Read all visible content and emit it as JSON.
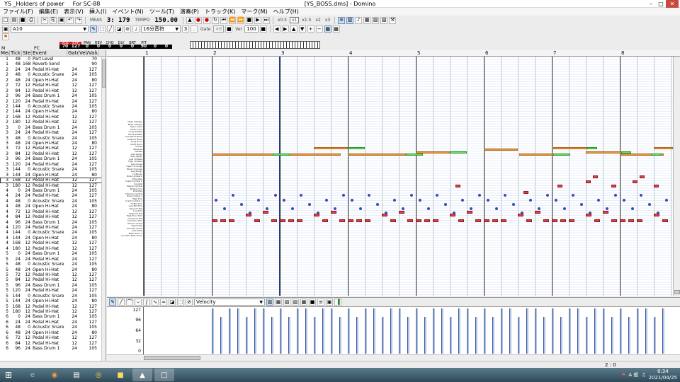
{
  "titlebar": {
    "app_name": "YS _Holders of power",
    "device": "For SC-88",
    "document": "[YS_BOSS.dms] - Domino"
  },
  "menu": [
    "ファイル(F)",
    "編集(E)",
    "表示(V)",
    "挿入(I)",
    "イベント(N)",
    "ツール(T)",
    "演奏(P)",
    "トラック(K)",
    "マーク(M)",
    "ヘルプ(H)"
  ],
  "toolbar": {
    "meas_label": "MEAS",
    "position": "3: 179",
    "tempo_label": "TEMPO",
    "tempo": "150.00",
    "zoom": [
      "x0.5",
      "x1",
      "x1.5",
      "x2",
      "x3"
    ],
    "track_select": "A10",
    "note_length": "16分音符",
    "gate_label": "Gate",
    "gate_value": "48",
    "vel_label": "Vel",
    "vel_value": "100"
  },
  "mixer": {
    "labels": [
      "VOL",
      "EXP",
      "PAN",
      "REV",
      "CHO",
      "DLY",
      "BRT",
      "PIT"
    ],
    "values": [
      "70",
      "127",
      "0",
      "0",
      "0",
      "0",
      "0",
      "90",
      "0",
      "0"
    ],
    "channel_m": "M",
    "channel_p": "PC"
  },
  "eventlist": {
    "headers": [
      "Mea",
      "Tick",
      "Step",
      "Event",
      "Gate",
      "Vel/Value"
    ],
    "rows": [
      [
        "1",
        "48",
        "0",
        "Part Level",
        "",
        "70"
      ],
      [
        "1",
        "48",
        "168",
        "Reverb Send",
        "",
        "90"
      ],
      [
        "2",
        "24",
        "24",
        "Pedal Hi-Hat",
        "24",
        "127"
      ],
      [
        "2",
        "48",
        "0",
        "Acoustic Snare",
        "24",
        "105"
      ],
      [
        "2",
        "48",
        "24",
        "Open Hi-Hat",
        "24",
        "80"
      ],
      [
        "2",
        "72",
        "12",
        "Pedal Hi-Hat",
        "12",
        "127"
      ],
      [
        "2",
        "84",
        "12",
        "Pedal Hi-Hat",
        "12",
        "127"
      ],
      [
        "2",
        "96",
        "24",
        "Bass Drum 1",
        "24",
        "105"
      ],
      [
        "2",
        "120",
        "24",
        "Pedal Hi-Hat",
        "24",
        "127"
      ],
      [
        "2",
        "144",
        "0",
        "Acoustic Snare",
        "24",
        "105"
      ],
      [
        "2",
        "144",
        "24",
        "Open Hi-Hat",
        "24",
        "80"
      ],
      [
        "2",
        "168",
        "12",
        "Pedal Hi-Hat",
        "12",
        "127"
      ],
      [
        "2",
        "180",
        "12",
        "Pedal Hi-Hat",
        "12",
        "127"
      ],
      [
        "3",
        "0",
        "24",
        "Bass Drum 1",
        "24",
        "105"
      ],
      [
        "3",
        "24",
        "24",
        "Pedal Hi-Hat",
        "24",
        "127"
      ],
      [
        "3",
        "48",
        "0",
        "Acoustic Snare",
        "24",
        "105"
      ],
      [
        "3",
        "48",
        "24",
        "Open Hi-Hat",
        "24",
        "80"
      ],
      [
        "3",
        "72",
        "12",
        "Pedal Hi-Hat",
        "12",
        "127"
      ],
      [
        "3",
        "84",
        "12",
        "Pedal Hi-Hat",
        "12",
        "127"
      ],
      [
        "3",
        "96",
        "24",
        "Bass Drum 1",
        "24",
        "105"
      ],
      [
        "3",
        "120",
        "24",
        "Pedal Hi-Hat",
        "24",
        "127"
      ],
      [
        "3",
        "144",
        "0",
        "Acoustic Snare",
        "24",
        "105"
      ],
      [
        "3",
        "144",
        "24",
        "Open Hi-Hat",
        "24",
        "80"
      ],
      [
        "3",
        "168",
        "12",
        "Pedal Hi-Hat",
        "12",
        "127"
      ],
      [
        "3",
        "180",
        "12",
        "Pedal Hi-Hat",
        "12",
        "127"
      ],
      [
        "4",
        "0",
        "24",
        "Bass Drum 1",
        "24",
        "105"
      ],
      [
        "4",
        "24",
        "24",
        "Pedal Hi-Hat",
        "24",
        "127"
      ],
      [
        "4",
        "48",
        "0",
        "Acoustic Snare",
        "24",
        "105"
      ],
      [
        "4",
        "48",
        "24",
        "Open Hi-Hat",
        "24",
        "80"
      ],
      [
        "4",
        "72",
        "12",
        "Pedal Hi-Hat",
        "12",
        "127"
      ],
      [
        "4",
        "84",
        "12",
        "Pedal Hi-Hat",
        "12",
        "127"
      ],
      [
        "4",
        "96",
        "24",
        "Bass Drum 1",
        "24",
        "105"
      ],
      [
        "4",
        "120",
        "24",
        "Pedal Hi-Hat",
        "24",
        "127"
      ],
      [
        "4",
        "144",
        "0",
        "Acoustic Snare",
        "24",
        "105"
      ],
      [
        "4",
        "144",
        "24",
        "Open Hi-Hat",
        "24",
        "80"
      ],
      [
        "4",
        "168",
        "12",
        "Pedal Hi-Hat",
        "12",
        "127"
      ],
      [
        "4",
        "180",
        "12",
        "Pedal Hi-Hat",
        "12",
        "127"
      ],
      [
        "5",
        "0",
        "24",
        "Bass Drum 1",
        "24",
        "105"
      ],
      [
        "5",
        "24",
        "24",
        "Pedal Hi-Hat",
        "24",
        "127"
      ],
      [
        "5",
        "48",
        "0",
        "Acoustic Snare",
        "24",
        "105"
      ],
      [
        "5",
        "48",
        "24",
        "Open Hi-Hat",
        "24",
        "80"
      ],
      [
        "5",
        "72",
        "12",
        "Pedal Hi-Hat",
        "12",
        "127"
      ],
      [
        "5",
        "84",
        "12",
        "Pedal Hi-Hat",
        "12",
        "127"
      ],
      [
        "5",
        "96",
        "24",
        "Bass Drum 1",
        "24",
        "105"
      ],
      [
        "5",
        "120",
        "24",
        "Pedal Hi-Hat",
        "24",
        "127"
      ],
      [
        "5",
        "144",
        "0",
        "Acoustic Snare",
        "24",
        "105"
      ],
      [
        "5",
        "144",
        "24",
        "Open Hi-Hat",
        "24",
        "80"
      ],
      [
        "5",
        "168",
        "12",
        "Pedal Hi-Hat",
        "12",
        "127"
      ],
      [
        "5",
        "180",
        "12",
        "Pedal Hi-Hat",
        "12",
        "127"
      ],
      [
        "6",
        "0",
        "24",
        "Bass Drum 1",
        "24",
        "105"
      ],
      [
        "6",
        "24",
        "24",
        "Pedal Hi-Hat",
        "24",
        "127"
      ],
      [
        "6",
        "48",
        "0",
        "Acoustic Snare",
        "24",
        "105"
      ],
      [
        "6",
        "48",
        "24",
        "Open Hi-Hat",
        "24",
        "80"
      ],
      [
        "6",
        "72",
        "12",
        "Pedal Hi-Hat",
        "12",
        "127"
      ],
      [
        "6",
        "84",
        "12",
        "Pedal Hi-Hat",
        "12",
        "127"
      ],
      [
        "6",
        "96",
        "24",
        "Bass Drum 1",
        "24",
        "105"
      ]
    ],
    "selected_row": 23
  },
  "pianoroll": {
    "measures": [
      "1",
      "2",
      "3",
      "4",
      "5",
      "6",
      "7",
      "8"
    ],
    "drum_names": [
      "Open Triangle",
      "Mute Triangle",
      "Open Cuica",
      "Mute Cuica",
      "Long Whistle",
      "Short Whistle",
      "Low Wood Block",
      "Hi Wood Block",
      "Long Guiro",
      "Short Guiro",
      "Claves",
      "Maracas",
      "Cabasa",
      "Low Agogo",
      "High Agogo",
      "Low Timbale",
      "High Timbale",
      "Low Conga",
      "Open Hi Conga",
      "Mute Hi Conga",
      "Low Bongo",
      "Hi Bongo",
      "Ride Cymbal 2",
      "Vibra-slap",
      "Crash Cymbal 2",
      "Cowbell",
      "Splash Cymbal",
      "Tambourine",
      "Ride Bell",
      "Chinese Cymbal",
      "Ride Cymbal 1",
      "High Tom",
      "Crash Cymbal 1",
      "Hi-Mid Tom",
      "Low-Mid Tom",
      "Open Hi-Hat",
      "Low Tom",
      "Pedal Hi-Hat",
      "High Floor Tom",
      "Closed Hi-Hat",
      "Low Floor Tom",
      "Electric Snare",
      "Hand Clap",
      "Acoustic Snare",
      "Side Stick",
      "Bass Drum 1",
      "Acoustic Bass Drum"
    ]
  },
  "controller": {
    "type": "Velocity",
    "scale": [
      "127",
      "96",
      "64",
      "32",
      "0"
    ]
  },
  "status": {
    "position": "2 : 0"
  },
  "taskbar": {
    "tray_text": "A 般",
    "time": "8:34",
    "date": "2021/04/25"
  }
}
